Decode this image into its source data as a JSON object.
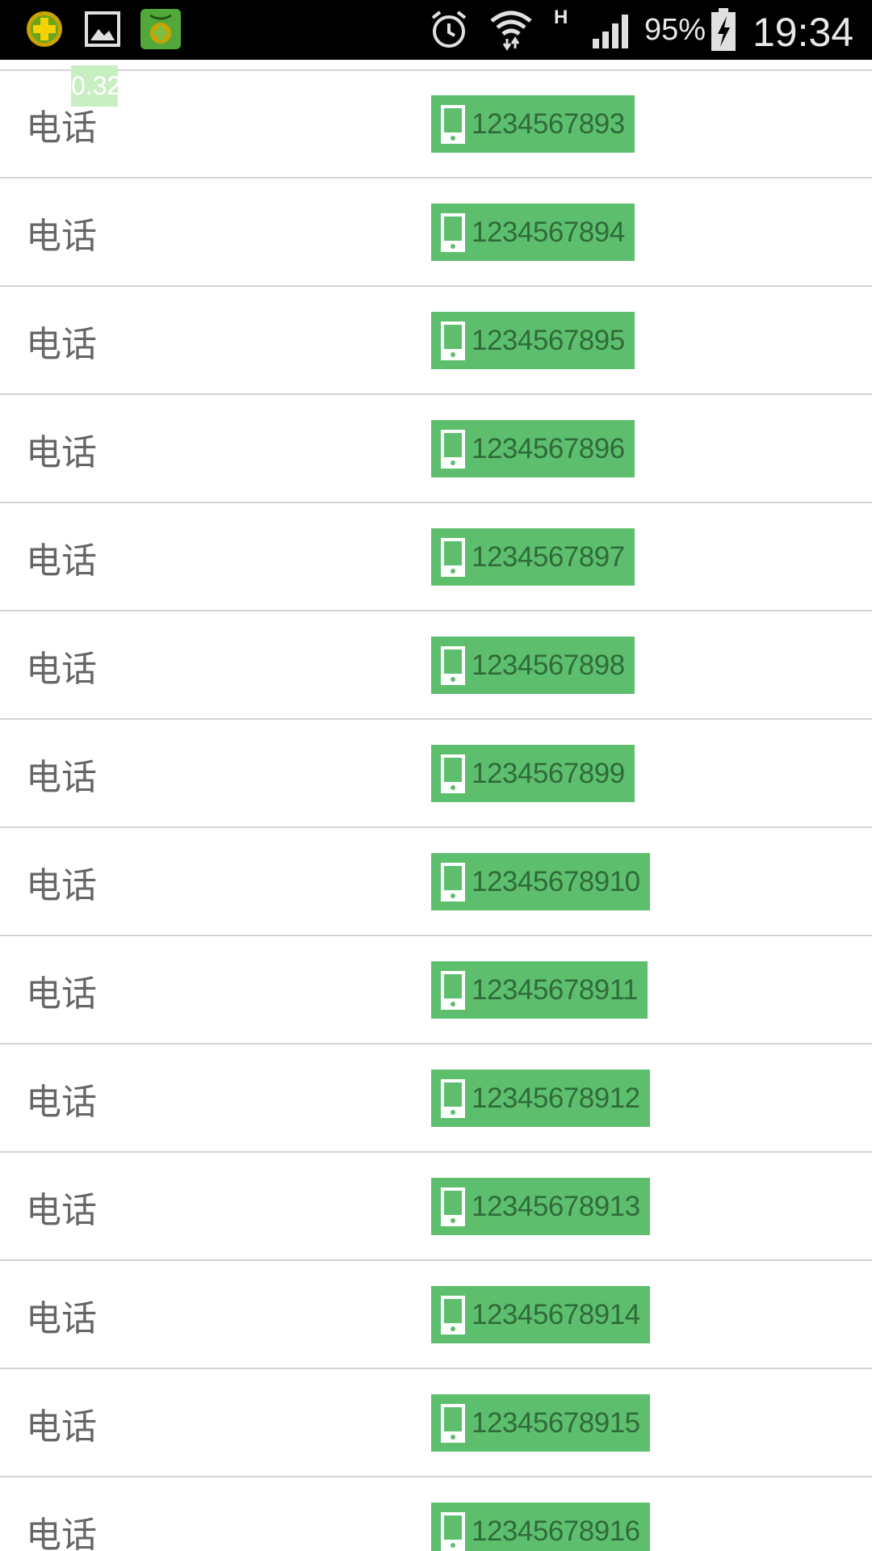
{
  "status_bar": {
    "battery": "95%",
    "time": "19:34",
    "network_type": "H",
    "icons": [
      "security-app-icon",
      "gallery-icon",
      "security-app-green-icon",
      "alarm-icon",
      "wifi-icon",
      "signal-icon",
      "battery-charging-icon"
    ]
  },
  "overlay": {
    "badge_text": "0.32"
  },
  "list": {
    "rows": [
      {
        "label": "电话",
        "phone": "1234567893"
      },
      {
        "label": "电话",
        "phone": "1234567894"
      },
      {
        "label": "电话",
        "phone": "1234567895"
      },
      {
        "label": "电话",
        "phone": "1234567896"
      },
      {
        "label": "电话",
        "phone": "1234567897"
      },
      {
        "label": "电话",
        "phone": "1234567898"
      },
      {
        "label": "电话",
        "phone": "1234567899"
      },
      {
        "label": "电话",
        "phone": "12345678910"
      },
      {
        "label": "电话",
        "phone": "12345678911"
      },
      {
        "label": "电话",
        "phone": "12345678912"
      },
      {
        "label": "电话",
        "phone": "12345678913"
      },
      {
        "label": "电话",
        "phone": "12345678914"
      },
      {
        "label": "电话",
        "phone": "12345678915"
      },
      {
        "label": "电话",
        "phone": "12345678916"
      }
    ]
  },
  "colors": {
    "button_green": "#5dbf6d",
    "phone_text": "#2f6b3a",
    "label_text": "#666666",
    "divider": "#d4d4d4"
  }
}
